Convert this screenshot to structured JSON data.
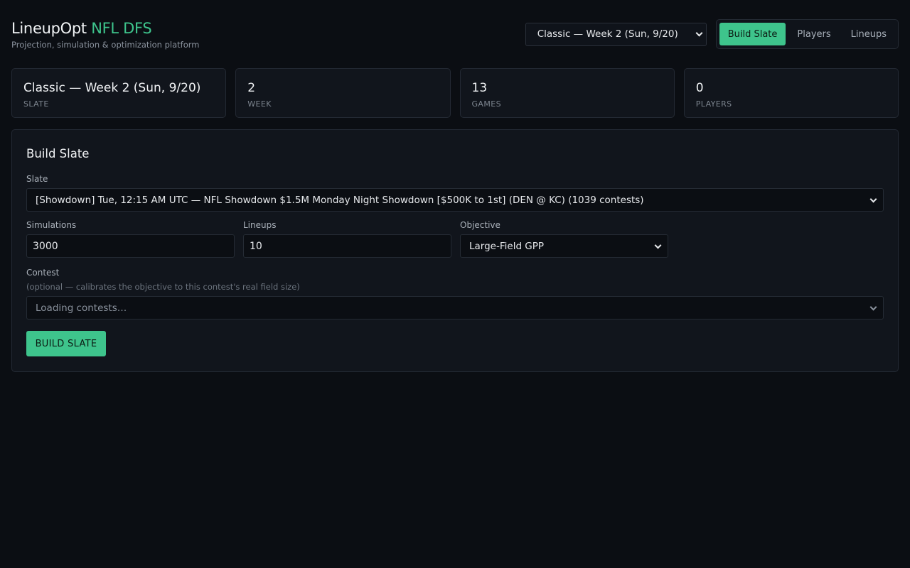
{
  "header": {
    "brand_main": "LineupOpt",
    "brand_accent": "NFL DFS",
    "subtitle": "Projection, simulation & optimization platform",
    "slate_select_value": "Classic — Week 2 (Sun, 9/20)",
    "nav": [
      {
        "label": "Build Slate",
        "active": true
      },
      {
        "label": "Players",
        "active": false
      },
      {
        "label": "Lineups",
        "active": false
      }
    ]
  },
  "stats": [
    {
      "value": "Classic — Week 2 (Sun, 9/20)",
      "label": "Slate"
    },
    {
      "value": "2",
      "label": "Week"
    },
    {
      "value": "13",
      "label": "Games"
    },
    {
      "value": "0",
      "label": "Players"
    }
  ],
  "panel": {
    "title": "Build Slate",
    "slate_label": "Slate",
    "slate_value": "[Showdown] Tue, 12:15 AM UTC — NFL Showdown $1.5M Monday Night Showdown [$500K to 1st] (DEN @ KC) (1039 contests)",
    "simulations_label": "Simulations",
    "simulations_value": "3000",
    "lineups_label": "Lineups",
    "lineups_value": "10",
    "objective_label": "Objective",
    "objective_value": "Large-Field GPP",
    "contest_label": "Contest",
    "contest_hint": "(optional — calibrates the objective to this contest's real field size)",
    "contest_value": "Loading contests…",
    "build_button": "BUILD SLATE"
  },
  "colors": {
    "accent": "#3ec48c",
    "background": "#0b0e13",
    "card": "#11151c"
  },
  "icons": {
    "dropdown": "chevron-down-icon"
  }
}
